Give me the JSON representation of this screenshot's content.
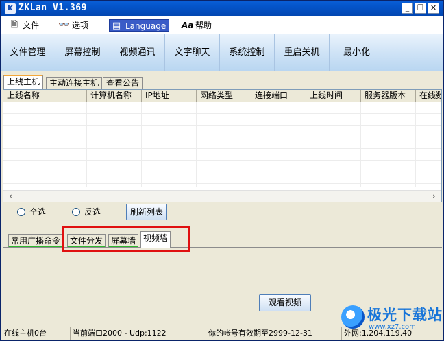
{
  "window": {
    "title": "ZKLan V1.369",
    "app_icon": "K"
  },
  "menu": {
    "items": [
      {
        "label": "文件",
        "icon": "file-icon"
      },
      {
        "label": "选项",
        "icon": "glasses-icon"
      },
      {
        "label": "Language",
        "icon": "language-icon"
      },
      {
        "label": "帮助",
        "icon": "help-icon"
      }
    ]
  },
  "toolbar": {
    "buttons": [
      "文件管理",
      "屏幕控制",
      "视频通讯",
      "文字聊天",
      "系统控制",
      "重启关机",
      "最小化"
    ]
  },
  "top_tabs": [
    "上线主机",
    "主动连接主机",
    "查看公告"
  ],
  "list": {
    "columns": [
      "上线名称",
      "计算机名称",
      "IP地址",
      "网络类型",
      "连接端口",
      "上线时间",
      "服务器版本",
      "在线数"
    ]
  },
  "select_row": {
    "select_all": "全选",
    "invert": "反选",
    "refresh": "刷新列表"
  },
  "bottom_tabs": [
    "常用广播命令",
    "文件分发",
    "屏幕墙",
    "视频墙"
  ],
  "video_panel": {
    "watch_button": "观看视频"
  },
  "status": {
    "online": "在线主机0台",
    "port": "当前端口2000 - Udp:1122",
    "expiry": "你的帐号有效期至2999-12-31",
    "wan": "外网:1.204.119.40"
  },
  "watermark": {
    "text": "极光下载站",
    "sub": "www.xz7.com"
  },
  "colors": {
    "title_bar": "#0453c8",
    "highlight_box": "#e01010",
    "active_tab_accent": "#f3a73a",
    "tab_underline": "#2fb82f"
  }
}
